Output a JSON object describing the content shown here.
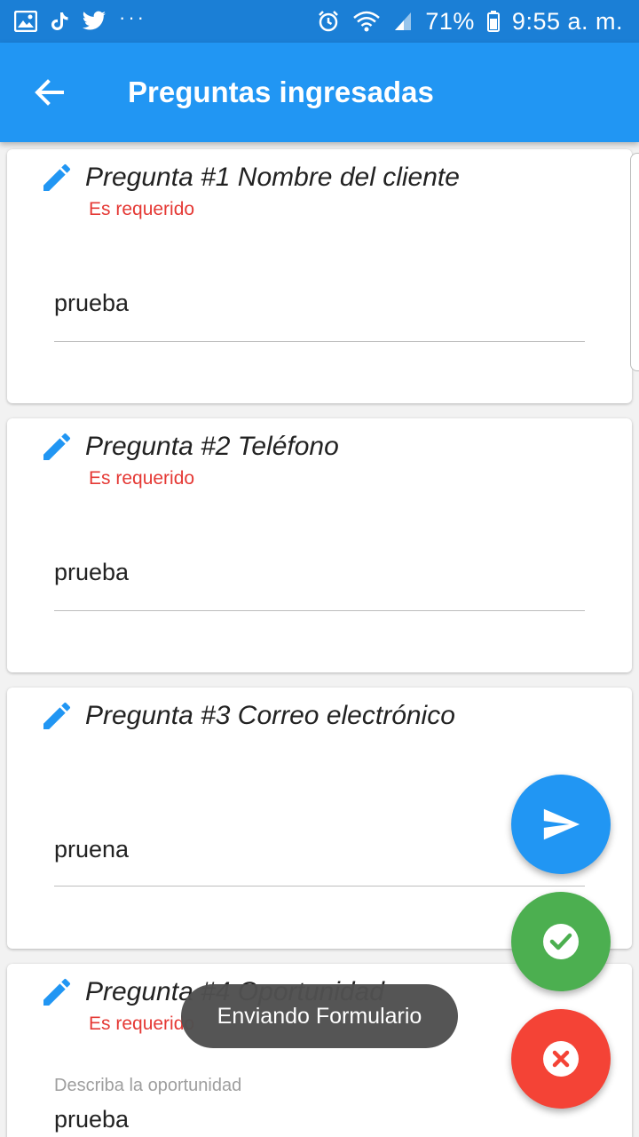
{
  "status_bar": {
    "icons_left": [
      "gallery-icon",
      "tiktok-icon",
      "twitter-icon"
    ],
    "more": "···",
    "icons_right": [
      "alarm-icon",
      "wifi-icon",
      "signal-icon"
    ],
    "battery": "71%",
    "time": "9:55 a. m."
  },
  "app_bar": {
    "title": "Preguntas ingresadas",
    "back_icon": "arrow-back-icon"
  },
  "questions": [
    {
      "title": "Pregunta #1 Nombre del cliente",
      "required": "Es requerido",
      "value": "prueba"
    },
    {
      "title": "Pregunta #2 Teléfono",
      "required": "Es requerido",
      "value": "prueba"
    },
    {
      "title": "Pregunta #3 Correo electrónico",
      "value": "pruena"
    },
    {
      "title": "Pregunta #4 Oportunidad",
      "required": "Es requerido",
      "label": "Describa la oportunidad",
      "value": "prueba"
    }
  ],
  "fabs": {
    "send_icon": "send-icon",
    "check_icon": "check-circle-icon",
    "cancel_icon": "cancel-icon"
  },
  "toast": {
    "text": "Enviando Formulario"
  },
  "colors": {
    "primary": "#2196f3",
    "status_bar": "#1b7fd6",
    "required": "#e53935",
    "success": "#4caf50",
    "danger": "#f44336"
  }
}
